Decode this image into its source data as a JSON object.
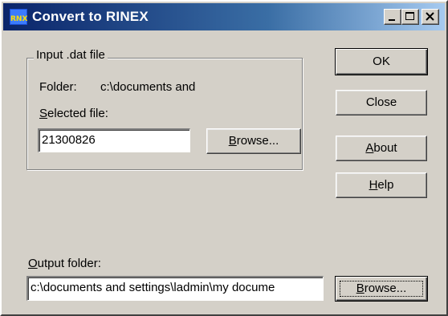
{
  "window": {
    "title": "Convert to RINEX",
    "icon_text": "RNX",
    "controls": [
      "minimize-icon",
      "maximize-icon",
      "close-icon"
    ]
  },
  "input_group": {
    "legend": "Input .dat file",
    "folder_label": "Folder:",
    "folder_value": "c:\\documents and",
    "selected_file_label_first": "S",
    "selected_file_label_rest": "elected file:",
    "selected_file_value": "21300826",
    "browse_first": "B",
    "browse_rest": "rowse..."
  },
  "buttons": {
    "ok": "OK",
    "close": "Close",
    "about_first": "A",
    "about_rest": "bout",
    "help_first": "H",
    "help_rest": "elp"
  },
  "output": {
    "label_first": "O",
    "label_rest": "utput folder:",
    "value": "c:\\documents and settings\\ladmin\\my docume",
    "browse_first": "B",
    "browse_rest": "rowse..."
  },
  "colors": {
    "face": "#d4d0c8",
    "title_start": "#0a246a",
    "title_end": "#a6caf0"
  }
}
